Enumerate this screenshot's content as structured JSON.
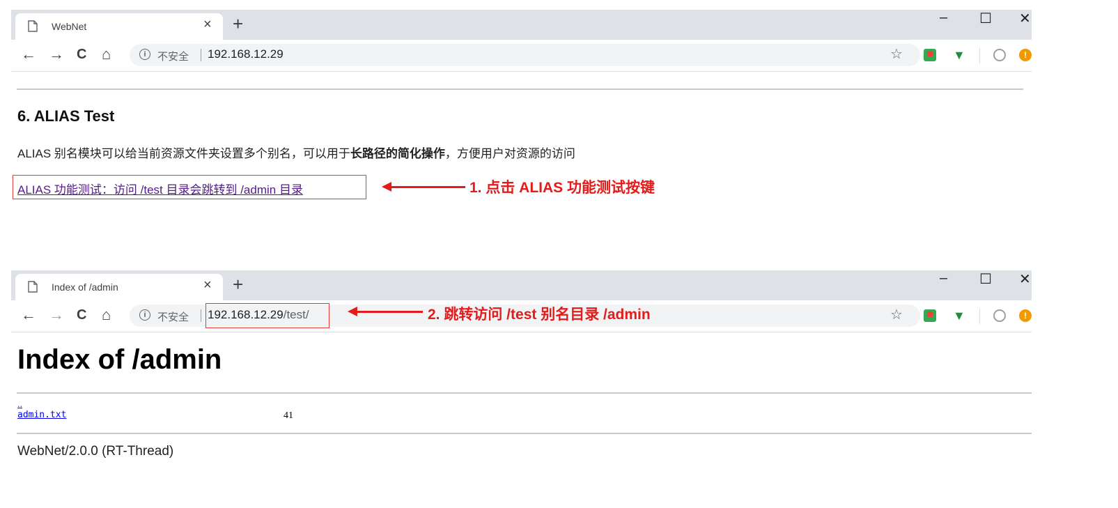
{
  "window1": {
    "tab_title": "WebNet",
    "tab_close": "×",
    "new_tab": "+",
    "minimize": "–",
    "maximize": "☐",
    "close": "✕",
    "security_label": "不安全",
    "url_host": "192.168.12.29",
    "url_path": "",
    "content": {
      "heading": "6. ALIAS Test",
      "desc_pre": "ALIAS 别名模块可以给当前资源文件夹设置多个别名，可以用于",
      "desc_bold": "长路径的简化操作",
      "desc_post": "，方便用户对资源的访问",
      "link_text": "ALIAS 功能测试：访问 /test 目录会跳转到 /admin 目录"
    },
    "annotation": "1. 点击 ALIAS 功能测试按键"
  },
  "window2": {
    "tab_title": "Index of /admin",
    "tab_close": "×",
    "new_tab": "+",
    "minimize": "–",
    "maximize": "☐",
    "close": "✕",
    "security_label": "不安全",
    "url_host": "192.168.12.29",
    "url_path": "/test/",
    "content": {
      "heading": "Index of /admin",
      "parent_link": "..",
      "files": [
        {
          "name": "admin.txt",
          "size": "41"
        }
      ],
      "footer": "WebNet/2.0.0 (RT-Thread)"
    },
    "annotation": "2.  跳转访问 /test 别名目录 /admin"
  },
  "icons": {
    "back": "←",
    "forward": "→",
    "reload": "C",
    "home": "⌂",
    "info": "i",
    "star": "☆",
    "shield": "▼",
    "warn": "!"
  },
  "colors": {
    "annotation": "#e31b1b",
    "link": "#551a8b",
    "tabstrip": "#dee1e6"
  }
}
